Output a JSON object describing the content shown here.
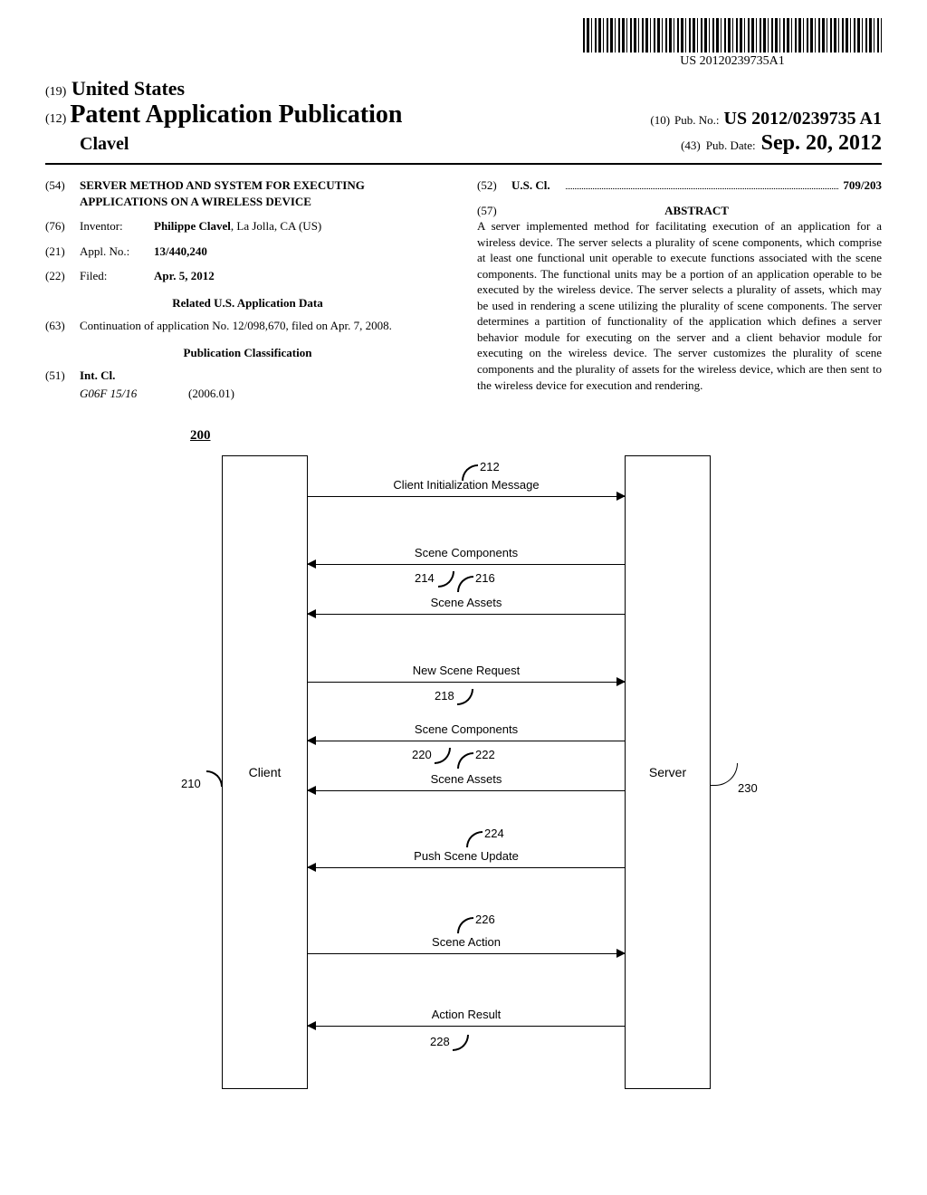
{
  "barcode_text": "US 20120239735A1",
  "header": {
    "country_prefix": "(19)",
    "country": "United States",
    "pub_type_prefix": "(12)",
    "pub_type": "Patent Application Publication",
    "author": "Clavel",
    "pub_no_prefix": "(10)",
    "pub_no_label": "Pub. No.:",
    "pub_no": "US 2012/0239735 A1",
    "pub_date_prefix": "(43)",
    "pub_date_label": "Pub. Date:",
    "pub_date": "Sep. 20, 2012"
  },
  "left_col": {
    "title_num": "(54)",
    "title": "SERVER METHOD AND SYSTEM FOR EXECUTING APPLICATIONS ON A WIRELESS DEVICE",
    "inventor_num": "(76)",
    "inventor_label": "Inventor:",
    "inventor": "Philippe Clavel",
    "inventor_loc": ", La Jolla, CA (US)",
    "appl_num_prefix": "(21)",
    "appl_num_label": "Appl. No.:",
    "appl_num": "13/440,240",
    "filed_prefix": "(22)",
    "filed_label": "Filed:",
    "filed": "Apr. 5, 2012",
    "related_heading": "Related U.S. Application Data",
    "continuation_num": "(63)",
    "continuation_text": "Continuation of application No. 12/098,670, filed on Apr. 7, 2008.",
    "pub_class_heading": "Publication Classification",
    "int_cl_num": "(51)",
    "int_cl_label": "Int. Cl.",
    "int_cl_code": "G06F 15/16",
    "int_cl_year": "(2006.01)"
  },
  "right_col": {
    "us_cl_num": "(52)",
    "us_cl_label": "U.S. Cl.",
    "us_cl_value": "709/203",
    "abstract_num": "(57)",
    "abstract_heading": "ABSTRACT",
    "abstract_text": "A server implemented method for facilitating execution of an application for a wireless device. The server selects a plurality of scene components, which comprise at least one functional unit operable to execute functions associated with the scene components. The functional units may be a portion of an application operable to be executed by the wireless device. The server selects a plurality of assets, which may be used in rendering a scene utilizing the plurality of scene components. The server determines a partition of functionality of the application which defines a server behavior module for executing on the server and a client behavior module for executing on the wireless device. The server customizes the plurality of scene components and the plurality of assets for the wireless device, which are then sent to the wireless device for execution and rendering."
  },
  "figure": {
    "fig_ref": "200",
    "client_label": "Client",
    "server_label": "Server",
    "client_ref": "210",
    "server_ref": "230",
    "messages": [
      {
        "label": "Client Initialization Message",
        "ref": "212",
        "dir": "right"
      },
      {
        "label": "Scene Components",
        "ref": "214",
        "dir": "left"
      },
      {
        "label": "Scene Assets",
        "ref": "216",
        "dir": "left"
      },
      {
        "label": "New Scene Request",
        "ref": "218",
        "dir": "right"
      },
      {
        "label": "Scene Components",
        "ref": "220",
        "dir": "left"
      },
      {
        "label": "Scene Assets",
        "ref": "222",
        "dir": "left"
      },
      {
        "label": "Push Scene Update",
        "ref": "224",
        "dir": "left"
      },
      {
        "label": "Scene Action",
        "ref": "226",
        "dir": "right"
      },
      {
        "label": "Action Result",
        "ref": "228",
        "dir": "left"
      }
    ]
  }
}
